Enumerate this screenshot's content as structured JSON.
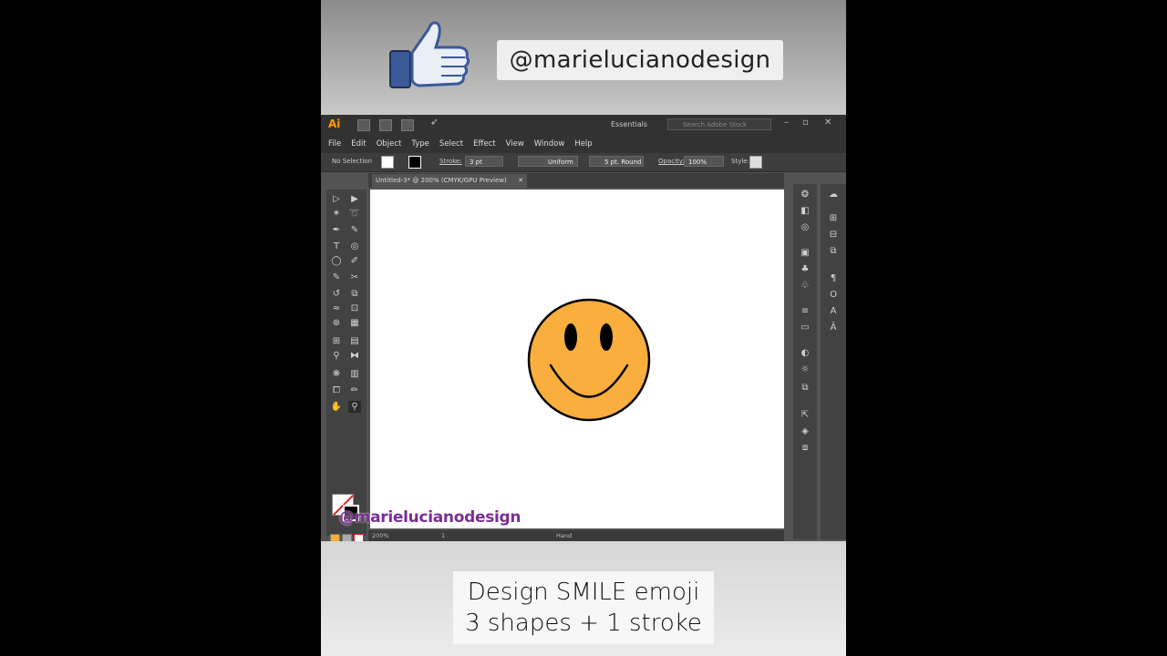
{
  "banner": {
    "handle": "@marielucianodesign",
    "thumb_icon": "thumbs-up-icon"
  },
  "app": {
    "logo": "Ai",
    "workspace": "Essentials",
    "search_placeholder": "Search Adobe Stock",
    "menu": [
      "File",
      "Edit",
      "Object",
      "Type",
      "Select",
      "Effect",
      "View",
      "Window",
      "Help"
    ],
    "control": {
      "selection": "No Selection",
      "stroke_label": "Stroke:",
      "stroke_weight": "3 pt",
      "profile": "Uniform",
      "brush": "5 pt. Round",
      "opacity_label": "Opacity:",
      "opacity_value": "100%",
      "style_label": "Style:"
    },
    "document_tab": "Untitled-3* @ 200% (CMYK/GPU Preview)",
    "status": {
      "zoom": "200%",
      "page": "1",
      "tool": "Hand"
    },
    "watermark": "@marielucianodesign"
  },
  "artwork": {
    "face_color": "#F9AE3D",
    "outline_color": "#000000"
  },
  "caption": {
    "line1": "Design SMILE emoji",
    "line2": "3 shapes + 1 stroke"
  }
}
